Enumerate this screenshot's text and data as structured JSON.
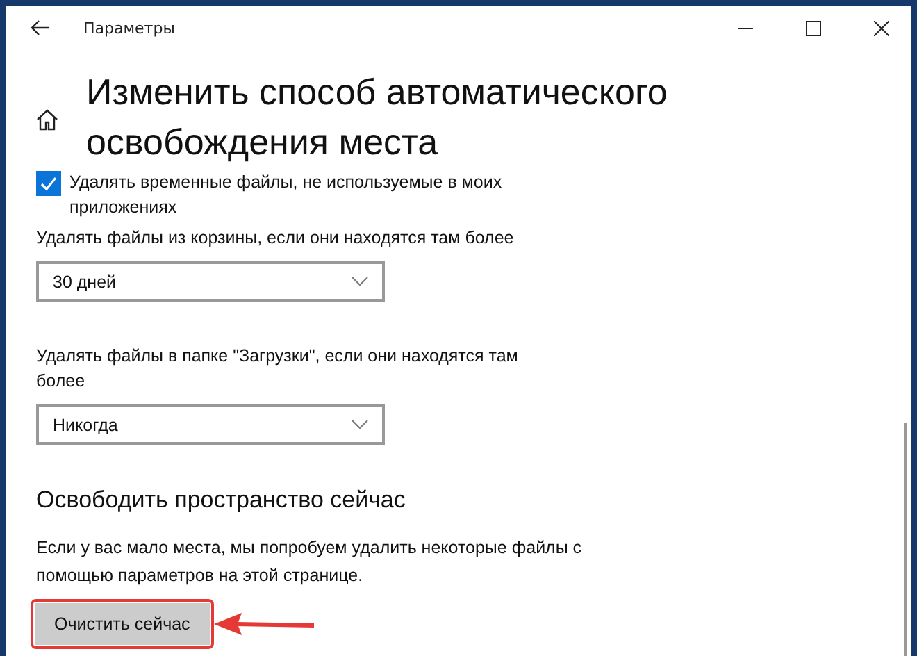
{
  "window": {
    "title": "Параметры"
  },
  "page": {
    "title": "Изменить способ автоматического освобождения места"
  },
  "settings": [
    {
      "kind": "checkbox",
      "label": "Удалять временные файлы, не используемые в моих приложениях",
      "checked": true
    },
    {
      "kind": "dropdown",
      "label": "Удалять файлы из корзины, если они находятся там более",
      "value": "30 дней"
    },
    {
      "kind": "dropdown",
      "label": "Удалять файлы в папке \"Загрузки\", если они находятся там более",
      "value": "Никогда"
    }
  ],
  "section": {
    "heading": "Освободить пространство сейчас",
    "description": "Если у вас мало места, мы попробуем удалить некоторые файлы с помощью параметров на этой странице.",
    "button": "Очистить сейчас"
  }
}
